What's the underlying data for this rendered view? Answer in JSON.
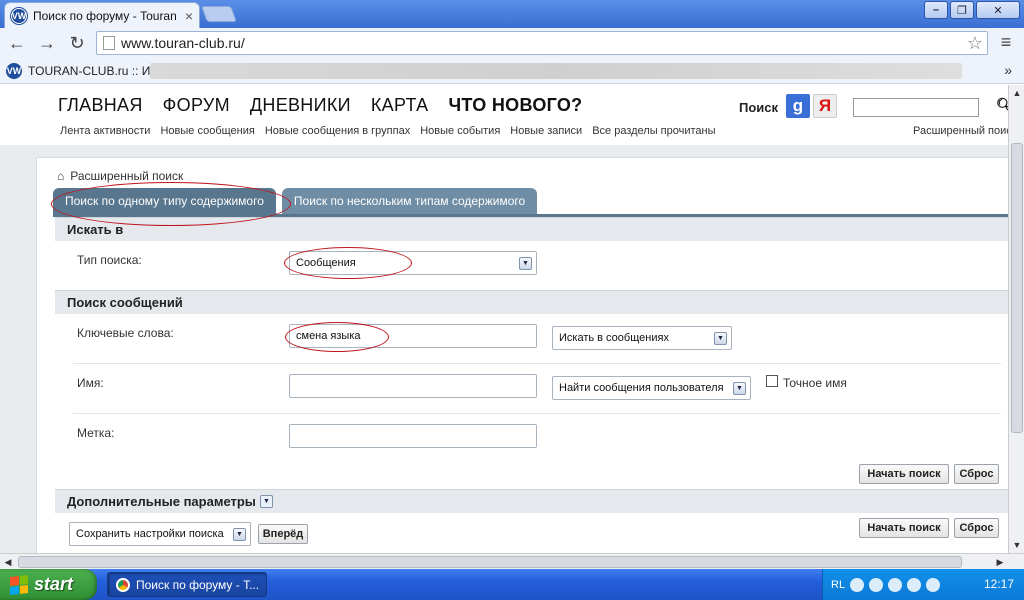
{
  "browser": {
    "tab_title": "Поиск по форуму - Touran C",
    "url": "www.touran-club.ru/",
    "bookmark_label": "TOURAN-CLUB.ru :: И..."
  },
  "header": {
    "main_nav": [
      "ГЛАВНАЯ",
      "ФОРУМ",
      "ДНЕВНИКИ",
      "КАРТА",
      "ЧТО НОВОГО?"
    ],
    "sub_nav": [
      "Лента активности",
      "Новые сообщения",
      "Новые сообщения в группах",
      "Новые события",
      "Новые записи",
      "Все разделы прочитаны"
    ],
    "search_label": "Поиск",
    "google_label": "g",
    "yandex_label": "Я",
    "advanced_link": "Расширенный поиск"
  },
  "breadcrumb": "Расширенный поиск",
  "tabs": [
    "Поиск по одному типу содержимого",
    "Поиск по нескольким типам содержимого"
  ],
  "search_in": {
    "heading": "Искать в",
    "type_label": "Тип поиска:",
    "type_value": "Сообщения"
  },
  "post_search": {
    "heading": "Поиск сообщений",
    "keywords_label": "Ключевые слова:",
    "keywords_value": "смена языка",
    "keywords_scope": "Искать в сообщениях",
    "name_label": "Имя:",
    "name_value": "",
    "name_scope": "Найти сообщения пользователя",
    "exact_name_label": "Точное имя",
    "tag_label": "Метка:",
    "tag_value": ""
  },
  "buttons": {
    "search": "Начать поиск",
    "reset": "Сброс",
    "forward": "Вперёд"
  },
  "extra": {
    "heading": "Дополнительные параметры",
    "save_settings": "Сохранить настройки поиска"
  },
  "taskbar": {
    "start": "start",
    "task_title": "Поиск по форуму - Т...",
    "lang": "RL",
    "clock": "12:17"
  },
  "colors": {
    "tab_active": "#58768e",
    "annotation": "#c0141a",
    "start_green": "#3a9c3e"
  }
}
